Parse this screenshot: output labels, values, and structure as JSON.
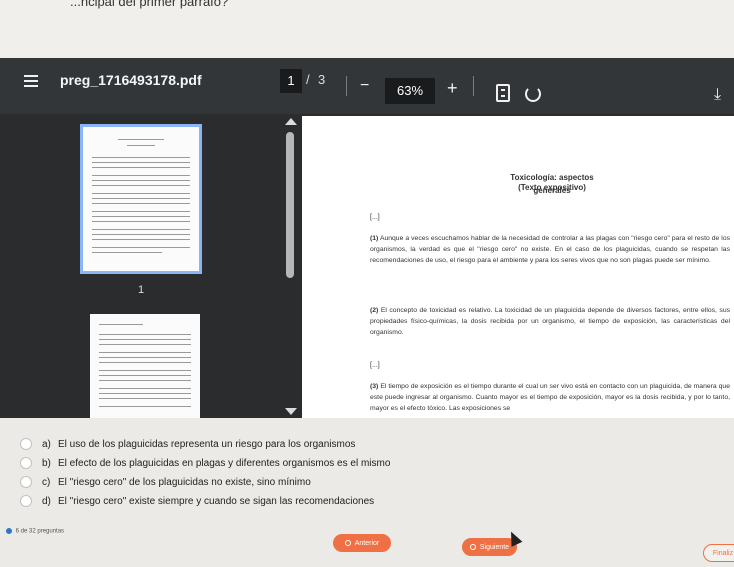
{
  "question_top_text": "...ncipal del primer párrafo?",
  "viewer": {
    "file_name": "preg_1716493178.pdf",
    "current_page": "1",
    "page_separator": "/",
    "total_pages": "3",
    "zoom_out": "−",
    "zoom_level": "63%",
    "zoom_in": "+",
    "download_icon": "download-icon",
    "fit_icon": "fit-page-icon",
    "rotate_icon": "rotate-icon"
  },
  "thumbnails": {
    "page_label": "1"
  },
  "document": {
    "title": "Toxicología: aspectos generales",
    "subtitle": "(Texto expositivo)",
    "ellipsis_1": "[...]",
    "ellipsis_2": "[...]",
    "para1_number": "(1)",
    "para1": "Aunque a veces escuchamos hablar de la necesidad de controlar a las plagas con \"riesgo cero\" para el resto de los organismos, la verdad es que el \"riesgo cero\" no existe. En el caso de los plaguicidas, cuando se respetan las recomendaciones de uso, el riesgo para el ambiente y para los seres vivos que no son plagas puede ser mínimo.",
    "para2_number": "(2)",
    "para2": "El concepto de toxicidad es relativo. La toxicidad de un plaguicida depende de diversos factores, entre ellos, sus propiedades físico-químicas, la dosis recibida por un organismo, el tiempo de exposición, las características del organismo.",
    "para3_number": "(3)",
    "para3": "El tiempo de exposición es el tiempo durante el cual un ser vivo está en contacto con un plaguicida, de manera que este puede ingresar al organismo. Cuanto mayor es el tiempo de exposición, mayor es la dosis recibida, y por lo tanto, mayor es el efecto tóxico. Las exposiciones se"
  },
  "options": [
    {
      "letter": "a)",
      "text": "El uso de los plaguicidas representa un riesgo para los organismos"
    },
    {
      "letter": "b)",
      "text": "El efecto de los plaguicidas en plagas y diferentes organismos es el mismo"
    },
    {
      "letter": "c)",
      "text": "El \"riesgo cero\" de los plaguicidas no existe, sino mínimo"
    },
    {
      "letter": "d)",
      "text": "El \"riesgo cero\" existe siempre y cuando se sigan las recomendaciones"
    }
  ],
  "footer": {
    "question_count": "6 de 32 preguntas",
    "prev_label": "Anterior",
    "next_label": "Siguiente",
    "finish_label": "Finaliz"
  },
  "colors": {
    "accent": "#ee7044",
    "toolbar": "#323639",
    "thumb_border": "#8ab4f8"
  }
}
